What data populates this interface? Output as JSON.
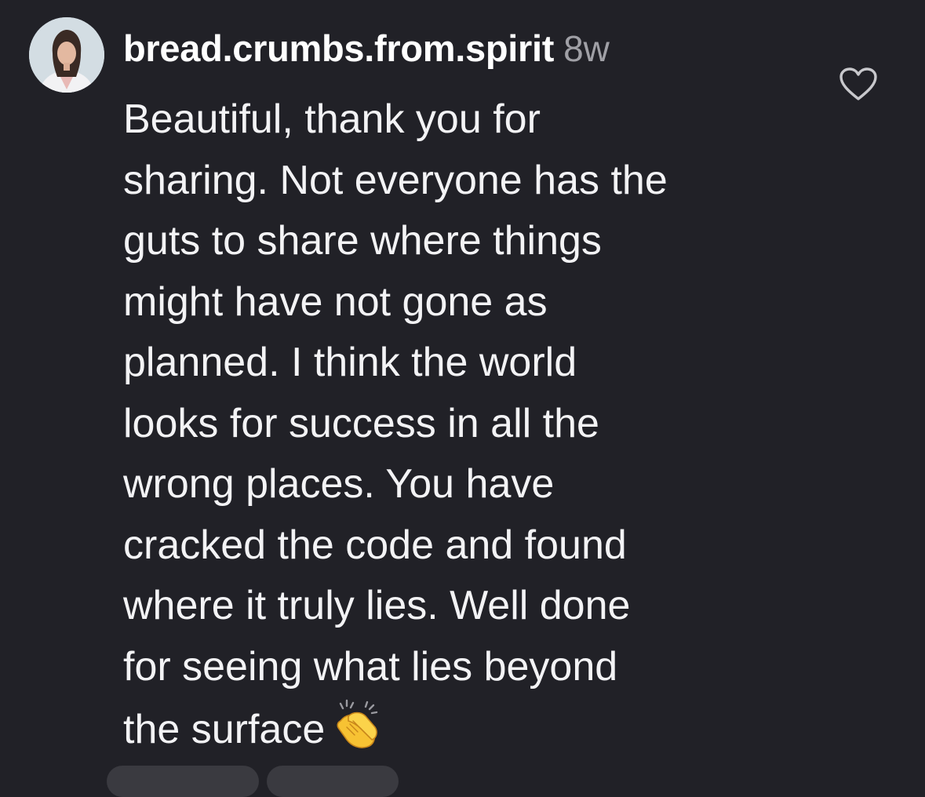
{
  "comment": {
    "username": "bread.crumbs.from.spirit",
    "timestamp": "8w",
    "lines": [
      "Beautiful, thank you for",
      "sharing. Not everyone has the",
      "guts to share where things",
      "might have not gone as",
      "planned. I think the world",
      "looks for success in all the",
      "wrong places. You have",
      "cracked the code and found",
      "where it truly lies.  Well done",
      "for seeing what lies beyond",
      "the surface"
    ],
    "emoji": "clapping-hands-emoji",
    "like_icon": "heart-outline-icon",
    "avatar_icon": "profile-photo"
  },
  "colors": {
    "background": "#212127",
    "text": "#f3f3f5",
    "timestamp": "#a0a0a6",
    "icon": "#c8c8cc"
  }
}
